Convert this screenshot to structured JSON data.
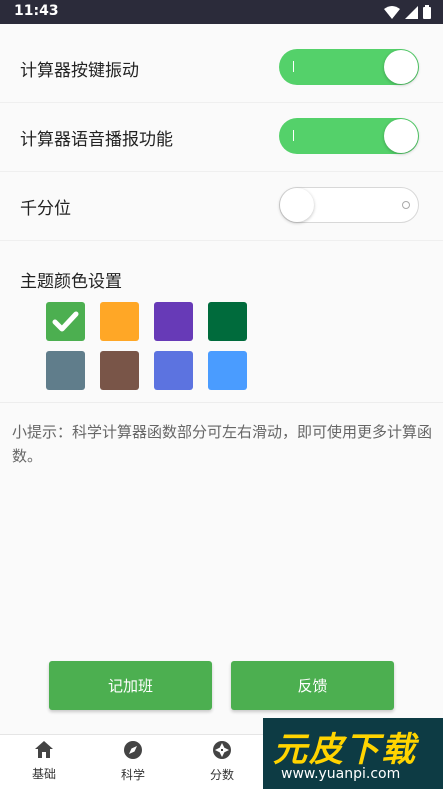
{
  "status_bar": {
    "time": "11:43"
  },
  "settings": [
    {
      "label": "计算器按键振动",
      "on": true
    },
    {
      "label": "计算器语音播报功能",
      "on": true
    },
    {
      "label": "千分位",
      "on": false
    }
  ],
  "theme": {
    "title": "主题颜色设置",
    "selected_index": 0,
    "colors": [
      "#4caf50",
      "#ffa726",
      "#673ab7",
      "#006b3c",
      "#607d8b",
      "#795548",
      "#5c73e0",
      "#4a9cff"
    ]
  },
  "hint": "小提示：科学计算器函数部分可左右滑动，即可使用更多计算函数。",
  "buttons": {
    "overtime": "记加班",
    "feedback": "反馈"
  },
  "nav": [
    {
      "label": "基础",
      "icon": "home-icon"
    },
    {
      "label": "科学",
      "icon": "compass-icon"
    },
    {
      "label": "分数",
      "icon": "aperture-icon"
    }
  ],
  "watermark": {
    "text": "元皮下载",
    "url": "www.yuanpi.com"
  }
}
